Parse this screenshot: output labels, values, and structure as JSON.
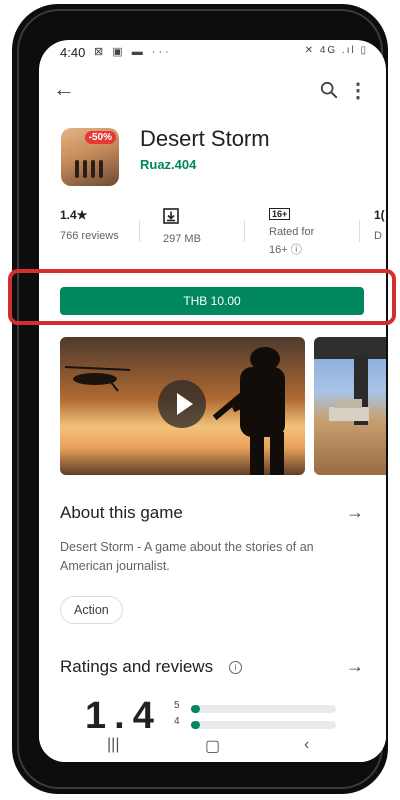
{
  "status": {
    "time": "4:40",
    "left_icons": "⊠ ▣ ▬ ···",
    "right_icons": "✕ 4G .ıl ▯"
  },
  "appbar": {
    "back_icon": "arrow-left-icon",
    "search_icon": "search-icon",
    "more_icon": "more-vert-icon"
  },
  "app": {
    "title": "Desert Storm",
    "developer": "Ruaz.404",
    "icon_badge": "-50%"
  },
  "stats": {
    "rating_value": "1.4★",
    "reviews": "766 reviews",
    "size": "297 MB",
    "rated_badge": "16+",
    "rated_line1": "Rated for",
    "rated_line2": "16+ ⓘ",
    "partial_value": "1(",
    "partial_label": "D"
  },
  "buy_button": {
    "label": "THB 10.00"
  },
  "about": {
    "title": "About this game",
    "description": "Desert Storm - A game about the stories of an American journalist.",
    "chip": "Action"
  },
  "ratings": {
    "title": "Ratings and reviews",
    "big_value": "1.4",
    "rows": [
      {
        "label": "5",
        "fraction": 0.06
      },
      {
        "label": "4",
        "fraction": 0.06
      }
    ]
  },
  "colors": {
    "accent": "#01875f",
    "highlight": "#d32f2f"
  }
}
